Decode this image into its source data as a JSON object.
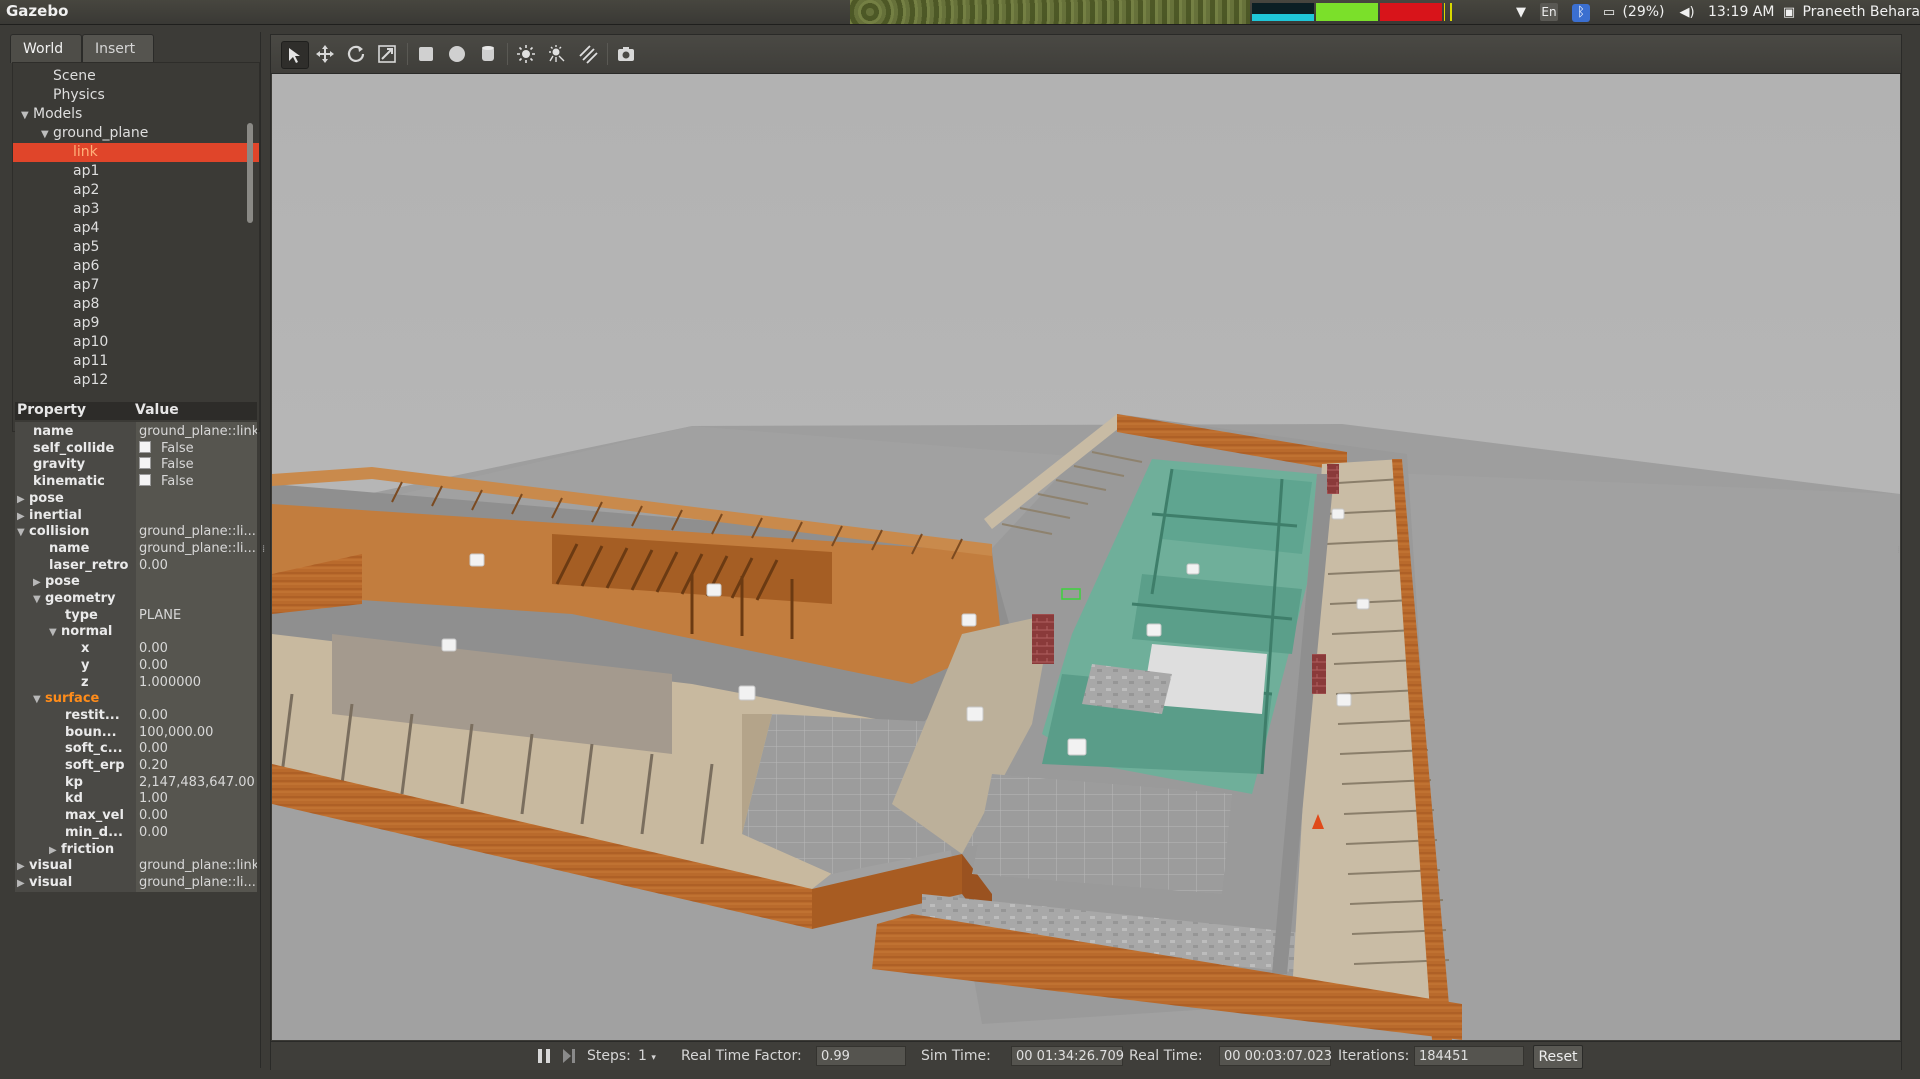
{
  "system_bar": {
    "app_name": "Gazebo",
    "keyboard_layout": "En",
    "battery_text": "(29%)",
    "clock": "13:19 AM",
    "user_name": "Praneeth Behara",
    "icons": [
      "wifi-icon",
      "keyboard-icon",
      "bluetooth-icon",
      "battery-icon",
      "volume-icon",
      "user-icon"
    ]
  },
  "left_panel": {
    "tabs": [
      {
        "label": "World",
        "active": true
      },
      {
        "label": "Insert",
        "active": false
      }
    ],
    "tree": [
      {
        "label": "Scene",
        "depth": 1,
        "expanded": null
      },
      {
        "label": "Physics",
        "depth": 1,
        "expanded": null
      },
      {
        "label": "Models",
        "depth": 0,
        "expanded": true
      },
      {
        "label": "ground_plane",
        "depth": 1,
        "expanded": true
      },
      {
        "label": "link",
        "depth": 2,
        "expanded": null,
        "selected": true
      },
      {
        "label": "ap1",
        "depth": 2
      },
      {
        "label": "ap2",
        "depth": 2
      },
      {
        "label": "ap3",
        "depth": 2
      },
      {
        "label": "ap4",
        "depth": 2
      },
      {
        "label": "ap5",
        "depth": 2
      },
      {
        "label": "ap6",
        "depth": 2
      },
      {
        "label": "ap7",
        "depth": 2
      },
      {
        "label": "ap8",
        "depth": 2
      },
      {
        "label": "ap9",
        "depth": 2
      },
      {
        "label": "ap10",
        "depth": 2
      },
      {
        "label": "ap11",
        "depth": 2
      },
      {
        "label": "ap12",
        "depth": 2
      }
    ],
    "property_header": {
      "name": "Property",
      "value": "Value"
    },
    "properties": [
      {
        "name": "name",
        "value": "ground_plane::link",
        "depth": 1
      },
      {
        "name": "self_collide",
        "value": "False",
        "checkbox": true,
        "depth": 1
      },
      {
        "name": "gravity",
        "value": "False",
        "checkbox": true,
        "depth": 1
      },
      {
        "name": "kinematic",
        "value": "False",
        "checkbox": true,
        "depth": 1
      },
      {
        "name": "pose",
        "value": "",
        "depth": 0,
        "arrow": "right"
      },
      {
        "name": "inertial",
        "value": "",
        "depth": 0,
        "arrow": "right"
      },
      {
        "name": "collision",
        "value": "ground_plane::li...",
        "depth": 0,
        "arrow": "down"
      },
      {
        "name": "name",
        "value": "ground_plane::li...",
        "depth": 2
      },
      {
        "name": "laser_retro",
        "value": "0.00",
        "depth": 2
      },
      {
        "name": "pose",
        "value": "",
        "depth": 1,
        "arrow": "right"
      },
      {
        "name": "geometry",
        "value": "",
        "depth": 1,
        "arrow": "down"
      },
      {
        "name": "type",
        "value": "PLANE",
        "depth": 3
      },
      {
        "name": "normal",
        "value": "",
        "depth": 2,
        "arrow": "down"
      },
      {
        "name": "x",
        "value": "0.00",
        "depth": 4
      },
      {
        "name": "y",
        "value": "0.00",
        "depth": 4
      },
      {
        "name": "z",
        "value": "1.000000",
        "depth": 4
      },
      {
        "name": "surface",
        "value": "",
        "depth": 1,
        "arrow": "down",
        "highlight": true
      },
      {
        "name": "restit...",
        "value": "0.00",
        "depth": 3
      },
      {
        "name": "boun...",
        "value": "100,000.00",
        "depth": 3
      },
      {
        "name": "soft_c...",
        "value": "0.00",
        "depth": 3
      },
      {
        "name": "soft_erp",
        "value": "0.20",
        "depth": 3
      },
      {
        "name": "kp",
        "value": "2,147,483,647.00",
        "depth": 3
      },
      {
        "name": "kd",
        "value": "1.00",
        "depth": 3
      },
      {
        "name": "max_vel",
        "value": "0.00",
        "depth": 3
      },
      {
        "name": "min_d...",
        "value": "0.00",
        "depth": 3
      },
      {
        "name": "friction",
        "value": "",
        "depth": 2,
        "arrow": "right"
      },
      {
        "name": "visual",
        "value": "ground_plane::link",
        "depth": 0,
        "arrow": "right"
      },
      {
        "name": "visual",
        "value": "ground_plane::li...",
        "depth": 0,
        "arrow": "right"
      }
    ]
  },
  "toolbar": {
    "tools": [
      "select-tool-icon",
      "translate-tool-icon",
      "rotate-tool-icon",
      "scale-tool-icon",
      "box-shape-icon",
      "sphere-shape-icon",
      "cylinder-shape-icon",
      "point-light-icon",
      "spot-light-icon",
      "directional-light-icon",
      "screenshot-icon"
    ]
  },
  "status_bar": {
    "steps_label": "Steps:",
    "steps_value": "1",
    "rtf_label": "Real Time Factor:",
    "rtf_value": "0.99",
    "sim_time_label": "Sim Time:",
    "sim_time_value": "00 01:34:26.709",
    "real_time_label": "Real Time:",
    "real_time_value": "00 00:03:07.023",
    "iterations_label": "Iterations:",
    "iterations_value": "184451",
    "reset_label": "Reset"
  },
  "colors": {
    "selection": "#e0452a",
    "highlight_text": "#ff8c1a",
    "viewport_bg": "#b4b4b4",
    "wood": "#b8672a",
    "teal_room": "#5fa590"
  }
}
